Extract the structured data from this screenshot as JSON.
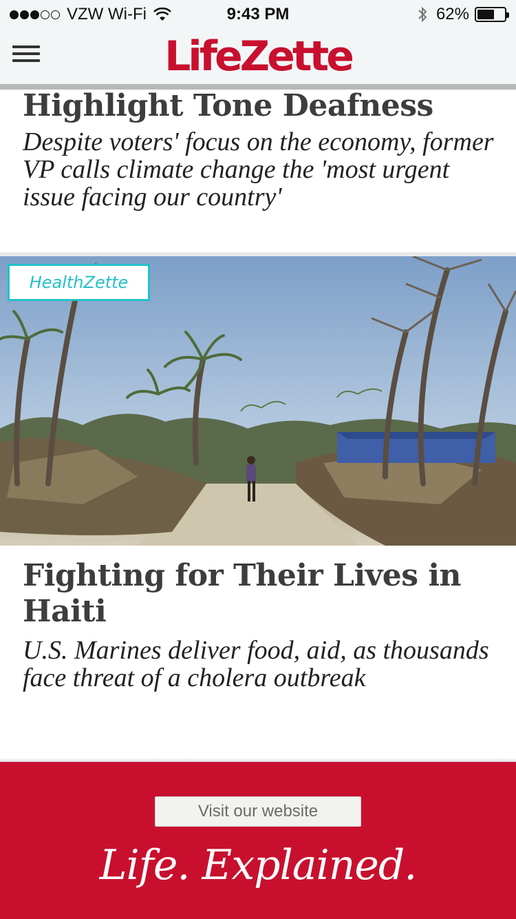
{
  "status_bar": {
    "carrier": "VZW Wi-Fi",
    "signal_dots_filled": 3,
    "signal_dots_total": 5,
    "time": "9:43 PM",
    "battery_percent": "62%",
    "battery_level": 0.62
  },
  "header": {
    "logo_text": "LifeZette",
    "brand_color": "#c8102e"
  },
  "articles": [
    {
      "title": "Highlight Tone Deafness",
      "dek": "Despite voters' focus on the economy, former VP calls climate change the 'most urgent issue facing our country'"
    },
    {
      "category": "HealthZette",
      "category_color": "#23c1c7",
      "image_alt": "Hurricane-damaged road in Haiti with fallen palm trees",
      "title": "Fighting for Their Lives in Haiti",
      "dek": "U.S. Marines deliver food, aid, as thousands face threat of a cholera outbreak"
    }
  ],
  "footer": {
    "visit_button_label": "Visit our website",
    "tagline": "Life. Explained."
  }
}
